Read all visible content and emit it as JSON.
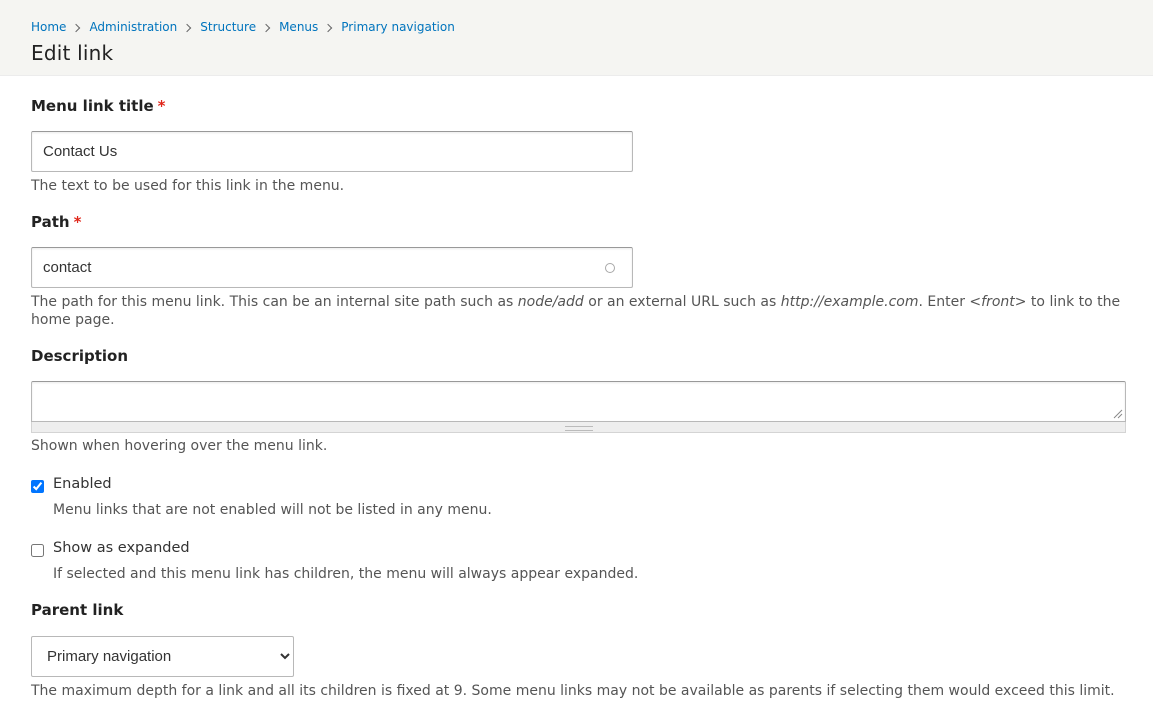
{
  "breadcrumb": {
    "items": [
      "Home",
      "Administration",
      "Structure",
      "Menus",
      "Primary navigation"
    ]
  },
  "page_title": "Edit link",
  "fields": {
    "title": {
      "label": "Menu link title",
      "required_marker": "*",
      "value": "Contact Us",
      "description": "The text to be used for this link in the menu."
    },
    "path": {
      "label": "Path",
      "required_marker": "*",
      "value": "contact",
      "description_parts": {
        "p1": "The path for this menu link. This can be an internal site path such as ",
        "em1": "node/add",
        "p2": " or an external URL such as ",
        "em2": "http://example.com",
        "p3": ". Enter ",
        "em3": "<front>",
        "p4": " to link to the home page."
      }
    },
    "description": {
      "label": "Description",
      "value": "",
      "help": "Shown when hovering over the menu link."
    },
    "enabled": {
      "label": "Enabled",
      "checked": true,
      "description": "Menu links that are not enabled will not be listed in any menu."
    },
    "expanded": {
      "label": "Show as expanded",
      "checked": false,
      "description": "If selected and this menu link has children, the menu will always appear expanded."
    },
    "parent": {
      "label": "Parent link",
      "selected": "Primary navigation",
      "description": "The maximum depth for a link and all its children is fixed at 9. Some menu links may not be available as parents if selecting them would exceed this limit."
    }
  },
  "colors": {
    "link": "#0074bd",
    "required": "#e0271b",
    "header_bg": "#f5f5f2"
  }
}
